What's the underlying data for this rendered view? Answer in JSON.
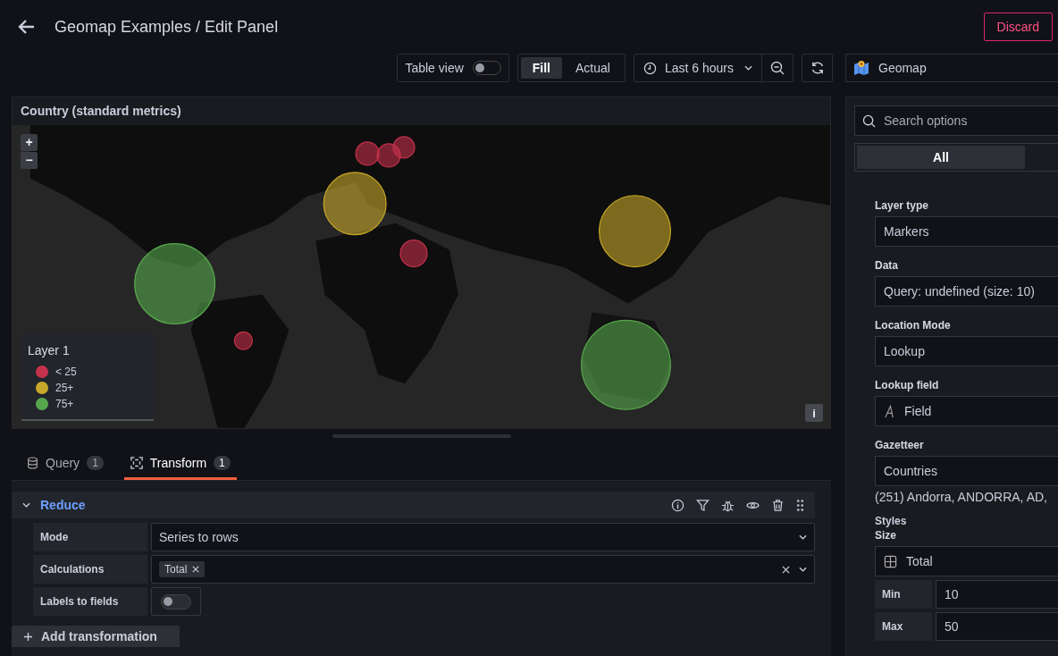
{
  "header": {
    "title": "Geomap Examples / Edit Panel",
    "discard": "Discard"
  },
  "toolbar": {
    "table_view": {
      "label": "Table view",
      "on": false
    },
    "size_modes": [
      {
        "label": "Fill",
        "selected": true
      },
      {
        "label": "Actual",
        "selected": false
      }
    ],
    "time_range": "Last 6 hours"
  },
  "visualization": "Geomap",
  "panel": {
    "title": "Country (standard metrics)",
    "zoom_in": "+",
    "zoom_out": "−",
    "info": "i",
    "legend": {
      "title": "Layer 1",
      "items": [
        {
          "label": "< 25",
          "color": "#c4314b"
        },
        {
          "label": "25+",
          "color": "#c8a82a"
        },
        {
          "label": "75+",
          "color": "#56a64b"
        }
      ]
    }
  },
  "tabs": [
    {
      "label": "Query",
      "count": "1",
      "selected": false
    },
    {
      "label": "Transform",
      "count": "1",
      "selected": true
    }
  ],
  "transformation": {
    "name": "Reduce",
    "expanded": true,
    "fields": [
      {
        "kind": "select",
        "label": "Mode",
        "value": "Series to rows"
      },
      {
        "kind": "tags",
        "label": "Calculations",
        "tags": [
          "Total"
        ]
      },
      {
        "kind": "switch",
        "label": "Labels to fields",
        "on": false
      }
    ]
  },
  "add_button": "Add transformation",
  "options": {
    "search": {
      "placeholder": "Search options"
    },
    "filters": [
      {
        "label": "All",
        "selected": true
      }
    ],
    "items": [
      {
        "kind": "select",
        "label": "Layer type",
        "value": "Markers"
      },
      {
        "kind": "select",
        "label": "Data",
        "value": "Query: undefined (size: 10)"
      },
      {
        "kind": "select",
        "label": "Location Mode",
        "value": "Lookup"
      },
      {
        "kind": "field",
        "label": "Lookup field",
        "value": "Field"
      },
      {
        "kind": "select",
        "label": "Gazetteer",
        "value": "Countries",
        "note": "(251) Andorra, ANDORRA, AD,"
      },
      {
        "kind": "heading",
        "label": "Styles"
      },
      {
        "kind": "calc",
        "label": "Size",
        "value": "Total"
      },
      {
        "kind": "pair",
        "label": "Min",
        "value": "10"
      },
      {
        "kind": "pair",
        "label": "Max",
        "value": "50"
      }
    ]
  }
}
